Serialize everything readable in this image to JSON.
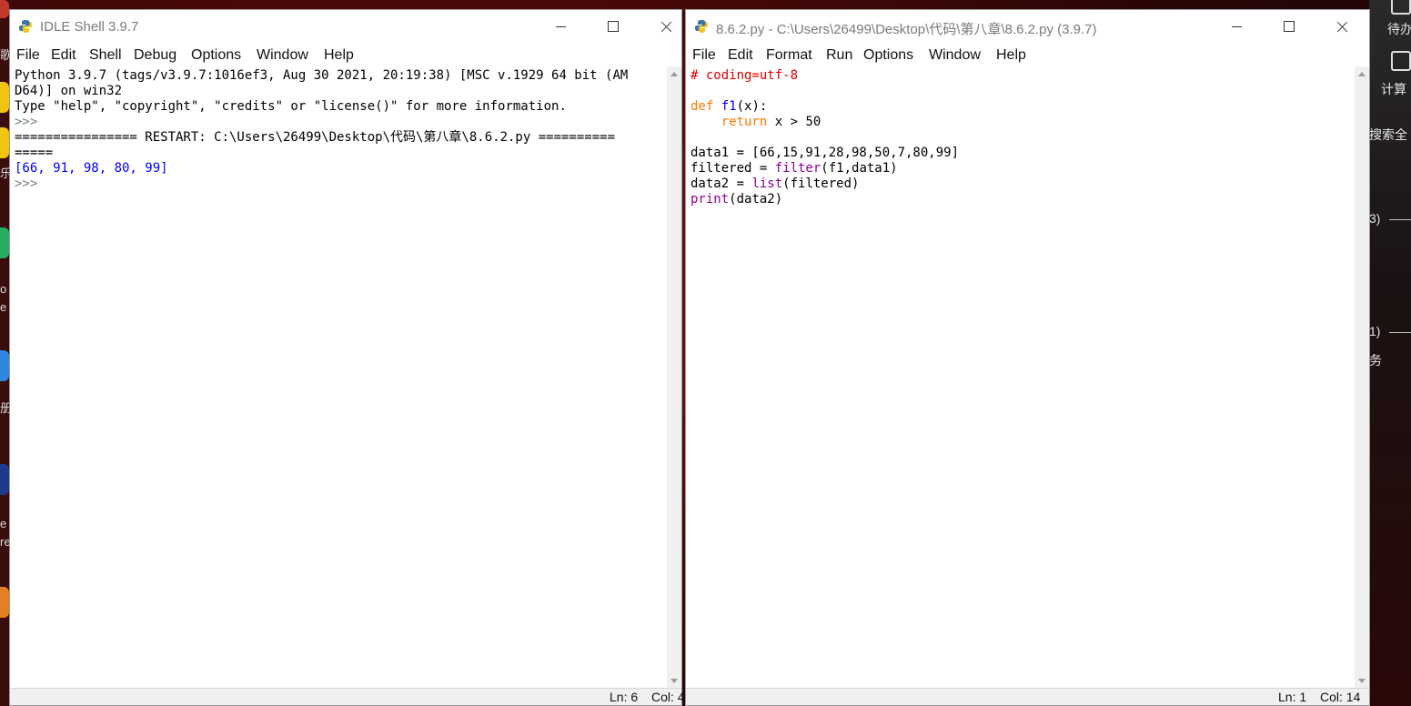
{
  "left_window": {
    "title": "IDLE Shell 3.9.7",
    "menu": [
      "File",
      "Edit",
      "Shell",
      "Debug",
      "Options",
      "Window",
      "Help"
    ],
    "lines": [
      {
        "text": "Python 3.9.7 (tags/v3.9.7:1016ef3, Aug 30 2021, 20:19:38) [MSC v.1929 64 bit (AM",
        "style": "plain"
      },
      {
        "text": "D64)] on win32",
        "style": "plain"
      },
      {
        "text": "Type \"help\", \"copyright\", \"credits\" or \"license()\" for more information.",
        "style": "plain"
      },
      {
        "text": ">>>",
        "style": "prompt"
      },
      {
        "text": "================ RESTART: C:\\Users\\26499\\Desktop\\代码\\第八章\\8.6.2.py ==========",
        "style": "plain"
      },
      {
        "text": "=====",
        "style": "plain"
      },
      {
        "text": "[66, 91, 98, 80, 99]",
        "style": "stdout"
      },
      {
        "text": ">>>",
        "style": "prompt"
      }
    ],
    "status": {
      "ln": "Ln: 6",
      "col": "Col: 4"
    }
  },
  "right_window": {
    "title": "8.6.2.py - C:\\Users\\26499\\Desktop\\代码\\第八章\\8.6.2.py (3.9.7)",
    "menu": [
      "File",
      "Edit",
      "Format",
      "Run",
      "Options",
      "Window",
      "Help"
    ],
    "code": {
      "l1": "# coding=utf-8",
      "l3_def": "def",
      "l3_name": "f1",
      "l3_rest": "(x):",
      "l4_indent": "    ",
      "l4_kw": "return",
      "l4_rest": " x > 50",
      "l6": "data1 = [66,15,91,28,98,50,7,80,99]",
      "l7_a": "filtered = ",
      "l7_b": "filter",
      "l7_c": "(f1,data1)",
      "l8_a": "data2 = ",
      "l8_b": "list",
      "l8_c": "(filtered)",
      "l9_b": "print",
      "l9_c": "(data2)"
    },
    "status": {
      "ln": "Ln: 1",
      "col": "Col: 14"
    }
  },
  "desktop": {
    "left_texts": [
      "歌",
      "乐",
      "o",
      "e",
      "册",
      "e",
      "re"
    ],
    "right_texts": [
      "待办",
      "计算",
      "搜索全",
      "3)",
      "1)",
      "务"
    ]
  }
}
